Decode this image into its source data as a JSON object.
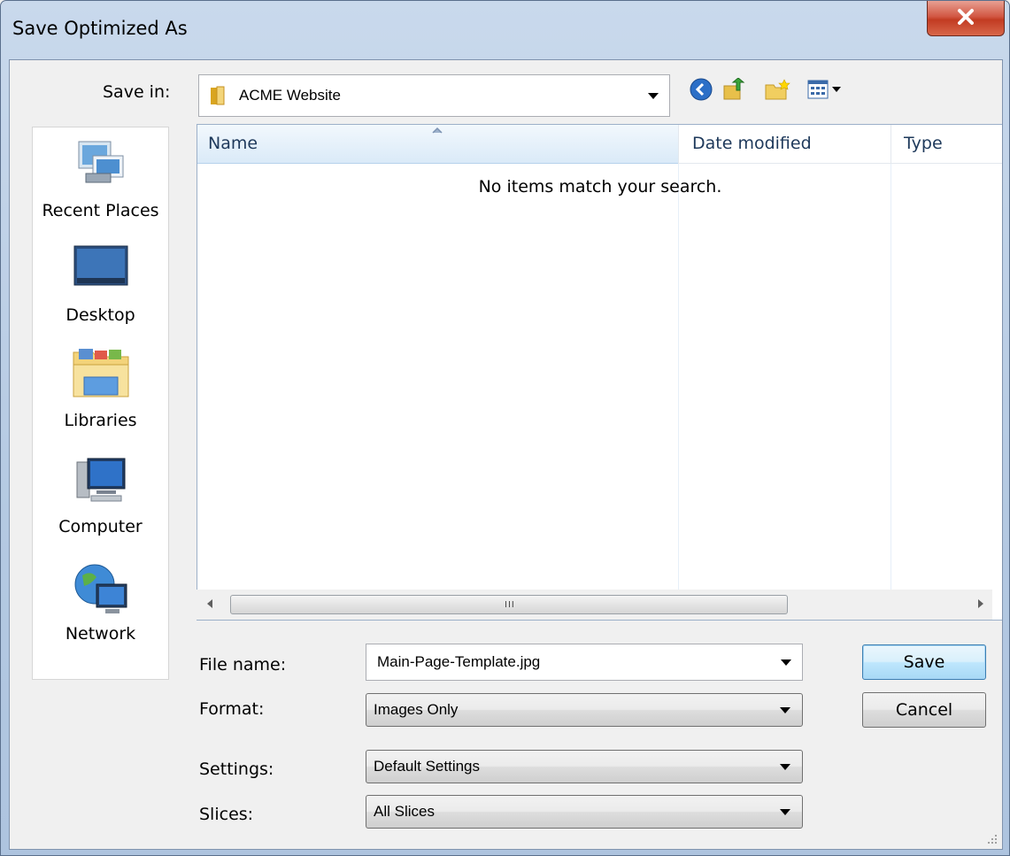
{
  "window": {
    "title": "Save Optimized As"
  },
  "save_in": {
    "label": "Save in:",
    "value": "ACME Website"
  },
  "places": [
    {
      "label": "Recent Places",
      "icon": "recent-places-icon"
    },
    {
      "label": "Desktop",
      "icon": "desktop-icon"
    },
    {
      "label": "Libraries",
      "icon": "libraries-icon"
    },
    {
      "label": "Computer",
      "icon": "computer-icon"
    },
    {
      "label": "Network",
      "icon": "network-icon"
    }
  ],
  "file_list": {
    "columns": [
      "Name",
      "Date modified",
      "Type"
    ],
    "empty_message": "No items match your search."
  },
  "fields": {
    "file_name": {
      "label": "File name:",
      "value": "Main-Page-Template.jpg"
    },
    "format": {
      "label": "Format:",
      "value": "Images Only"
    },
    "settings": {
      "label": "Settings:",
      "value": "Default Settings"
    },
    "slices": {
      "label": "Slices:",
      "value": "All Slices"
    }
  },
  "buttons": {
    "save": "Save",
    "cancel": "Cancel"
  },
  "colors": {
    "title_bar": "#b4c9e2",
    "close_button": "#c23b22",
    "header_text": "#1e395b"
  }
}
